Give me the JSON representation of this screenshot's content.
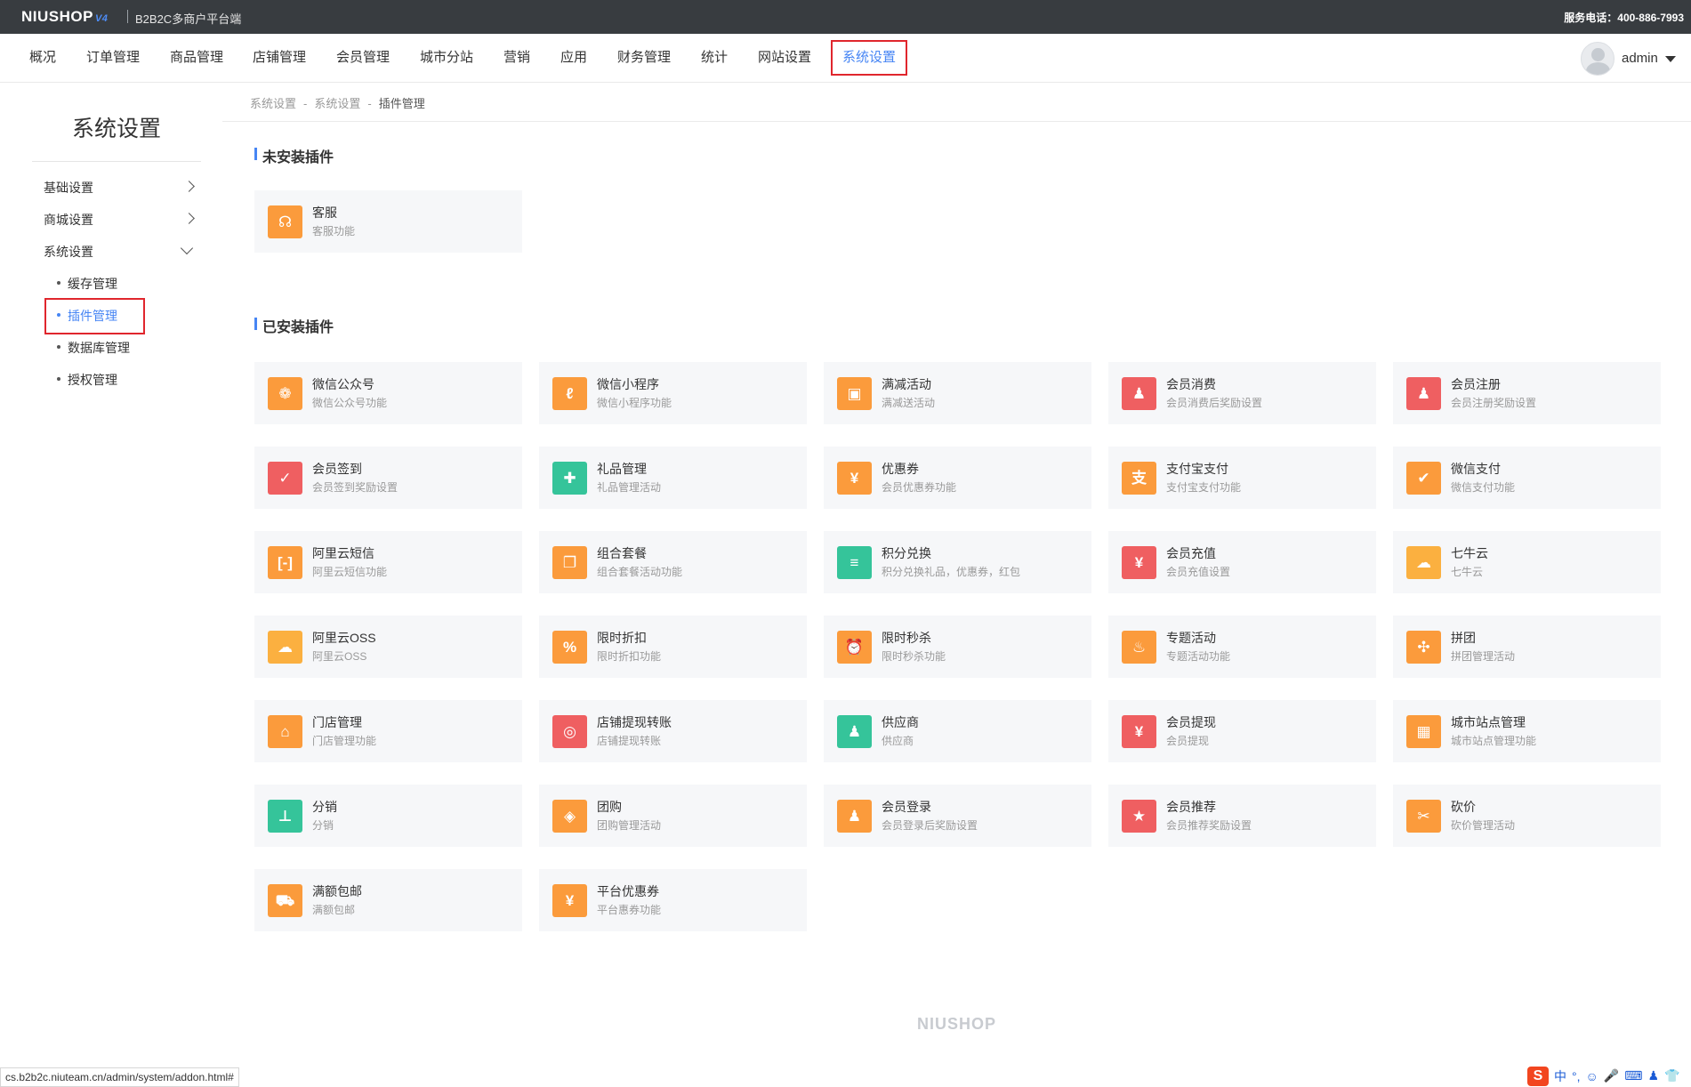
{
  "topbar": {
    "logo": "NIUSHOP",
    "logo_version": "V4",
    "platform": "B2B2C多商户平台端",
    "hotline": "服务电话：400-886-7993"
  },
  "nav": {
    "items": [
      {
        "label": "概况"
      },
      {
        "label": "订单管理"
      },
      {
        "label": "商品管理"
      },
      {
        "label": "店铺管理"
      },
      {
        "label": "会员管理"
      },
      {
        "label": "城市分站"
      },
      {
        "label": "营销"
      },
      {
        "label": "应用"
      },
      {
        "label": "财务管理"
      },
      {
        "label": "统计"
      },
      {
        "label": "网站设置"
      },
      {
        "label": "系统设置"
      }
    ],
    "active_index": 11,
    "user": "admin"
  },
  "sidebar": {
    "title": "系统设置",
    "groups": [
      {
        "label": "基础设置",
        "expanded": false
      },
      {
        "label": "商城设置",
        "expanded": false
      },
      {
        "label": "系统设置",
        "expanded": true
      }
    ],
    "sub_items": [
      {
        "label": "缓存管理"
      },
      {
        "label": "插件管理"
      },
      {
        "label": "数据库管理"
      },
      {
        "label": "授权管理"
      }
    ],
    "active_sub": "插件管理"
  },
  "breadcrumb": [
    "系统设置",
    "系统设置",
    "插件管理"
  ],
  "breadcrumb_sep": "-",
  "sections": {
    "uninstalled_title": "未安装插件",
    "installed_title": "已安装插件"
  },
  "uninstalled": [
    {
      "name": "客服",
      "desc": "客服功能",
      "icon": "headset-icon",
      "glyph": "☊",
      "color": "#fb9b3c"
    }
  ],
  "installed": [
    {
      "name": "微信公众号",
      "desc": "微信公众号功能",
      "icon": "wechat-icon",
      "glyph": "❁",
      "color": "#fb9b3c"
    },
    {
      "name": "微信小程序",
      "desc": "微信小程序功能",
      "icon": "mini-program-icon",
      "glyph": "ℓ",
      "color": "#fb9b3c"
    },
    {
      "name": "满减活动",
      "desc": "满减送活动",
      "icon": "ticket-icon",
      "glyph": "▣",
      "color": "#fb9b3c"
    },
    {
      "name": "会员消费",
      "desc": "会员消费后奖励设置",
      "icon": "member-consume-icon",
      "glyph": "♟",
      "color": "#ef5f61"
    },
    {
      "name": "会员注册",
      "desc": "会员注册奖励设置",
      "icon": "member-register-icon",
      "glyph": "♟",
      "color": "#ef5f61"
    },
    {
      "name": "会员签到",
      "desc": "会员签到奖励设置",
      "icon": "calendar-check-icon",
      "glyph": "✓",
      "color": "#ef5f61"
    },
    {
      "name": "礼品管理",
      "desc": "礼品管理活动",
      "icon": "gift-icon",
      "glyph": "✚",
      "color": "#35c49a"
    },
    {
      "name": "优惠券",
      "desc": "会员优惠券功能",
      "icon": "coupon-icon",
      "glyph": "¥",
      "color": "#fb9b3c"
    },
    {
      "name": "支付宝支付",
      "desc": "支付宝支付功能",
      "icon": "alipay-icon",
      "glyph": "支",
      "color": "#fb9b3c"
    },
    {
      "name": "微信支付",
      "desc": "微信支付功能",
      "icon": "wechat-pay-icon",
      "glyph": "✔",
      "color": "#fb9b3c"
    },
    {
      "name": "阿里云短信",
      "desc": "阿里云短信功能",
      "icon": "sms-icon",
      "glyph": "[-]",
      "color": "#fb9b3c"
    },
    {
      "name": "组合套餐",
      "desc": "组合套餐活动功能",
      "icon": "combo-icon",
      "glyph": "❐",
      "color": "#fb9b3c"
    },
    {
      "name": "积分兑换",
      "desc": "积分兑换礼品，优惠券，红包",
      "icon": "coins-icon",
      "glyph": "≡",
      "color": "#35c49a"
    },
    {
      "name": "会员充值",
      "desc": "会员充值设置",
      "icon": "recharge-icon",
      "glyph": "¥",
      "color": "#ef5f61"
    },
    {
      "name": "七牛云",
      "desc": "七牛云",
      "icon": "cloud-upload-icon",
      "glyph": "☁",
      "color": "#fbb040"
    },
    {
      "name": "阿里云OSS",
      "desc": "阿里云OSS",
      "icon": "cloud-oss-icon",
      "glyph": "☁",
      "color": "#fbb040"
    },
    {
      "name": "限时折扣",
      "desc": "限时折扣功能",
      "icon": "discount-icon",
      "glyph": "%",
      "color": "#fb9b3c"
    },
    {
      "name": "限时秒杀",
      "desc": "限时秒杀功能",
      "icon": "alarm-clock-icon",
      "glyph": "⏰",
      "color": "#fb9b3c"
    },
    {
      "name": "专题活动",
      "desc": "专题活动功能",
      "icon": "bulb-icon",
      "glyph": "♨",
      "color": "#fb9b3c"
    },
    {
      "name": "拼团",
      "desc": "拼团管理活动",
      "icon": "puzzle-icon",
      "glyph": "✣",
      "color": "#fb9b3c"
    },
    {
      "name": "门店管理",
      "desc": "门店管理功能",
      "icon": "store-settings-icon",
      "glyph": "⌂",
      "color": "#fb9b3c"
    },
    {
      "name": "店铺提现转账",
      "desc": "店铺提现转账",
      "icon": "withdraw-transfer-icon",
      "glyph": "◎",
      "color": "#ef5f61"
    },
    {
      "name": "供应商",
      "desc": "供应商",
      "icon": "supplier-icon",
      "glyph": "♟",
      "color": "#35c49a"
    },
    {
      "name": "会员提现",
      "desc": "会员提现",
      "icon": "member-withdraw-icon",
      "glyph": "¥",
      "color": "#ef5f61"
    },
    {
      "name": "城市站点管理",
      "desc": "城市站点管理功能",
      "icon": "building-icon",
      "glyph": "▦",
      "color": "#fb9b3c"
    },
    {
      "name": "分销",
      "desc": "分销",
      "icon": "sitemap-icon",
      "glyph": "⊥",
      "color": "#35c49a"
    },
    {
      "name": "团购",
      "desc": "团购管理活动",
      "icon": "tag-icon",
      "glyph": "◈",
      "color": "#fb9b3c"
    },
    {
      "name": "会员登录",
      "desc": "会员登录后奖励设置",
      "icon": "member-login-icon",
      "glyph": "♟",
      "color": "#fb9b3c"
    },
    {
      "name": "会员推荐",
      "desc": "会员推荐奖励设置",
      "icon": "recommend-star-icon",
      "glyph": "★",
      "color": "#ef5f61"
    },
    {
      "name": "砍价",
      "desc": "砍价管理活动",
      "icon": "bargain-icon",
      "glyph": "✂",
      "color": "#fb9b3c"
    },
    {
      "name": "满额包邮",
      "desc": "满额包邮",
      "icon": "truck-icon",
      "glyph": "⛟",
      "color": "#fb9b3c"
    },
    {
      "name": "平台优惠券",
      "desc": "平台惠券功能",
      "icon": "platform-coupon-icon",
      "glyph": "¥",
      "color": "#fb9b3c"
    }
  ],
  "footer_logo": "NIUSHOP",
  "status_url": "cs.b2b2c.niuteam.cn/admin/system/addon.html#",
  "tray": {
    "ime": "S",
    "lang": "中",
    "punct": "°,"
  }
}
